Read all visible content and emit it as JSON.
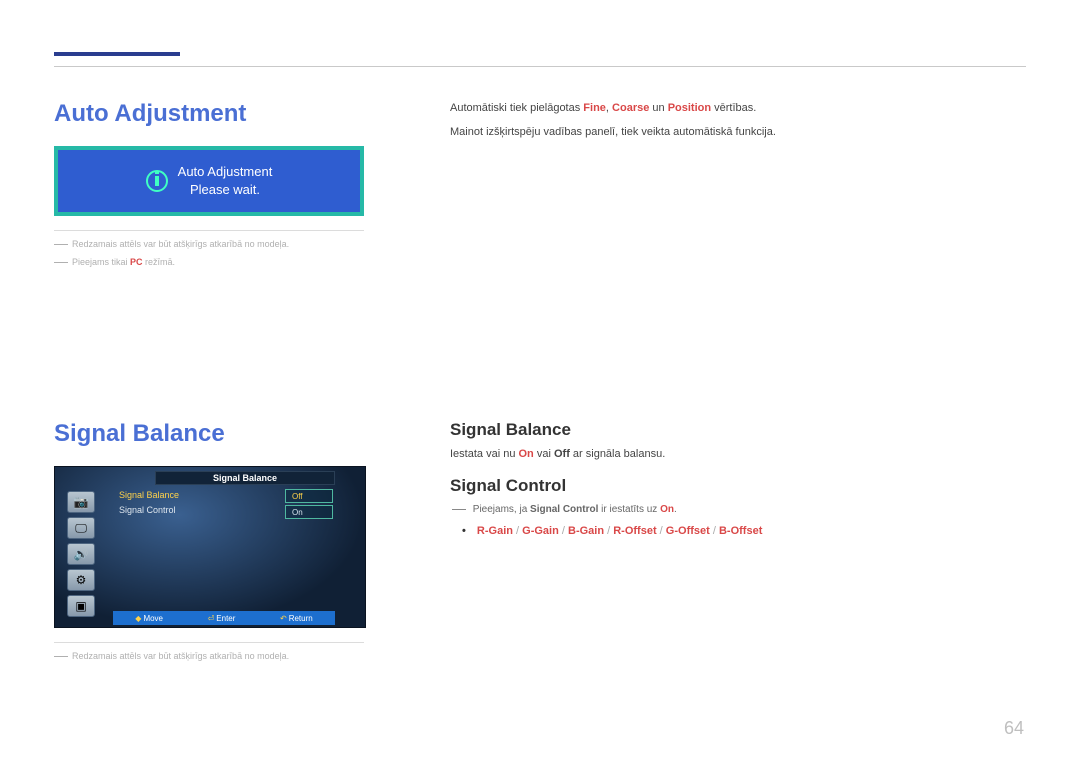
{
  "headings": {
    "auto_adjustment": "Auto Adjustment",
    "signal_balance_left": "Signal Balance",
    "signal_balance_right": "Signal Balance",
    "signal_control": "Signal Control"
  },
  "auto_adj_box": {
    "line1": "Auto Adjustment",
    "line2": "Please wait."
  },
  "notes": {
    "model_disclaimer": "Redzamais attēls var būt atšķirīgs atkarībā no modeļa.",
    "pc_only_pre": "Pieejams tikai ",
    "pc_bold": "PC",
    "pc_only_post": " režīmā."
  },
  "body": {
    "auto_line1_pre": "Automātiski tiek pielāgotas ",
    "auto_line1_fine": "Fine",
    "auto_line1_coarse": "Coarse",
    "auto_line1_un": " un ",
    "auto_line1_position": "Position",
    "auto_line1_post": " vērtības.",
    "auto_line2": "Mainot izšķirtspēju vadības panelī, tiek veikta automātiskā funkcija.",
    "sigbal_pre": "Iestata vai nu ",
    "sigbal_on": "On",
    "sigbal_mid": " vai ",
    "sigbal_off": "Off",
    "sigbal_post": " ar signāla balansu.",
    "sigctl_note_pre": "Pieejams, ja ",
    "sigctl_bold": "Signal Control",
    "sigctl_note_mid": " ir iestatīts uz ",
    "sigctl_on": "On",
    "sigctl_note_post": "."
  },
  "gains": {
    "rgain": "R-Gain",
    "ggain": "G-Gain",
    "bgain": "B-Gain",
    "roff": "R-Offset",
    "goff": "G-Offset",
    "boff": "B-Offset",
    "sep": " / "
  },
  "osd": {
    "title": "Signal Balance",
    "row1": "Signal Balance",
    "row2": "Signal Control",
    "val_off": "Off",
    "val_on": "On",
    "hint_move": "Move",
    "hint_enter": "Enter",
    "hint_return": "Return"
  },
  "page_number": "64",
  "comma": ", "
}
